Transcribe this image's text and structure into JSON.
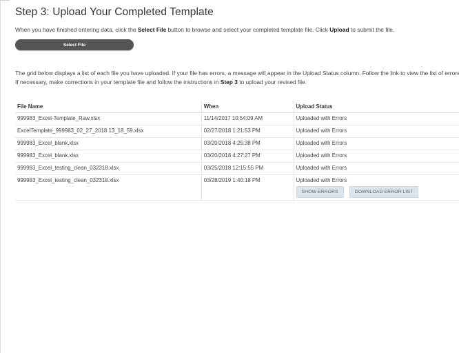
{
  "page": {
    "title": "Step 3: Upload Your Completed Template",
    "instructions1": {
      "pre": "When you have finished entering data, click the ",
      "bold1": "Select File",
      "mid": " button to browse and select your completed template file. Click ",
      "bold2": "Upload",
      "post": " to submit the file."
    },
    "select_file_label": "Select File",
    "instructions2": {
      "pre": "The grid below displays a list of each file you have uploaded. If your file has errors, a message will appear in the Upload Status column. Follow the link to view the list of errors. If necessary, make corrections in your template file and follow the instructions in ",
      "bold": "Step 3",
      "post": " to upload your revised file."
    }
  },
  "grid": {
    "headers": [
      "File Name",
      "When",
      "Upload Status"
    ],
    "rows": [
      {
        "file": "999983_Excel-Template_Raw.xlsx",
        "when": "11/14/2017 10:54:09 AM",
        "status": "Uploaded with Errors"
      },
      {
        "file": "ExcelTemplate_999983_02_27_2018 13_18_59.xlsx",
        "when": "02/27/2018 1:21:53 PM",
        "status": "Uploaded with Errors"
      },
      {
        "file": "999983_Excel_blank.xlsx",
        "when": "03/20/2018 4:25:38 PM",
        "status": "Uploaded with Errors"
      },
      {
        "file": "999983_Excel_blank.xlsx",
        "when": "03/20/2018 4:27:27 PM",
        "status": "Uploaded with Errors"
      },
      {
        "file": "999983_Excel_testing_clean_032318.xlsx",
        "when": "03/25/2018 12:15:55 PM",
        "status": "Uploaded with Errors"
      },
      {
        "file": "999983_Excel_testing_clean_032318.xlsx",
        "when": "03/28/2019 1:40:18 PM",
        "status": "Uploaded with Errors"
      }
    ],
    "show_errors_label": "SHOW ERRORS",
    "download_error_list_label": "DOWNLOAD ERROR LIST"
  },
  "colors": {
    "button_dark": "#555555",
    "action_button_bg": "#dbe5ee",
    "action_button_text": "#4a5f73"
  }
}
